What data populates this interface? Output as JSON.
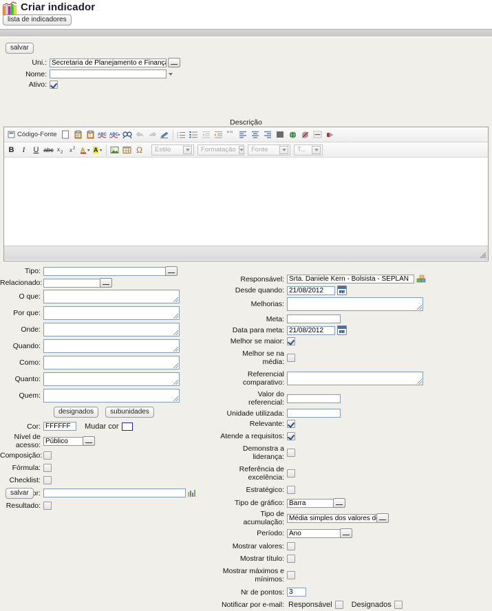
{
  "header": {
    "title": "Criar indicador",
    "logo_icon": "bar-chart-logo"
  },
  "nav": {
    "list_button": "lista de indicadores"
  },
  "actions": {
    "save_top": "salvar",
    "save_bottom": "salvar"
  },
  "top_fields": {
    "uni_label": "Uni.:",
    "uni_value": "Secretaria de Planejamento e Finanças",
    "nome_label": "Nome:",
    "nome_value": "",
    "ativo_label": "Ativo:",
    "ativo_checked": true
  },
  "description": {
    "label": "Descrição",
    "body_value": ""
  },
  "editor": {
    "row1": [
      {
        "name": "source-icon",
        "label": "Código-Fonte"
      },
      {
        "name": "new-page-icon"
      },
      {
        "name": "paste-word-icon"
      },
      {
        "name": "paste-text-icon"
      },
      {
        "name": "spellcheck-icon"
      },
      {
        "name": "spellcheck-options-icon"
      },
      {
        "name": "find-replace-icon"
      },
      {
        "name": "undo-icon"
      },
      {
        "name": "redo-icon"
      },
      {
        "name": "remove-format-icon"
      },
      {
        "name": "numbered-list-icon"
      },
      {
        "name": "bulleted-list-icon"
      },
      {
        "name": "outdent-icon"
      },
      {
        "name": "indent-icon"
      },
      {
        "name": "blockquote-icon"
      },
      {
        "name": "align-left-icon"
      },
      {
        "name": "align-center-icon"
      },
      {
        "name": "align-right-icon"
      },
      {
        "name": "justify-icon"
      },
      {
        "name": "link-icon"
      },
      {
        "name": "unlink-icon"
      },
      {
        "name": "horizontal-rule-icon"
      },
      {
        "name": "anchor-icon"
      }
    ],
    "row2": [
      {
        "name": "bold-icon",
        "glyph": "B"
      },
      {
        "name": "italic-icon",
        "glyph": "I"
      },
      {
        "name": "underline-icon",
        "glyph": "U"
      },
      {
        "name": "strikethrough-icon",
        "glyph": "abc"
      },
      {
        "name": "subscript-icon",
        "glyph": "x2"
      },
      {
        "name": "superscript-icon",
        "glyph": "x2"
      },
      {
        "name": "text-color-icon",
        "glyph": "A"
      },
      {
        "name": "bg-color-icon",
        "glyph": "A"
      },
      {
        "name": "image-icon"
      },
      {
        "name": "table-icon"
      },
      {
        "name": "special-char-icon",
        "glyph": "Ω"
      }
    ],
    "selects": [
      {
        "name": "style-select",
        "label": "Estilo"
      },
      {
        "name": "format-select",
        "label": "Formatação"
      },
      {
        "name": "font-select",
        "label": "Fonte"
      },
      {
        "name": "size-select",
        "label": "T..."
      }
    ]
  },
  "left_column": {
    "tipo_label": "Tipo:",
    "tipo_value": "",
    "relacionado_label": "Relacionado:",
    "relacionado_value": "",
    "oque_label": "O que:",
    "oque_value": "",
    "porque_label": "Por que:",
    "porque_value": "",
    "onde_label": "Onde:",
    "onde_value": "",
    "quando_label": "Quando:",
    "quando_value": "",
    "como_label": "Como:",
    "como_value": "",
    "quanto_label": "Quanto:",
    "quanto_value": "",
    "quem_label": "Quem:",
    "quem_value": "",
    "designados_button": "designados",
    "subunidades_button": "subunidades",
    "cor_label": "Cor:",
    "cor_value": "FFFFFF",
    "mudar_cor_label": "Mudar cor",
    "nivel_acesso_label": "Nível de acesso:",
    "nivel_acesso_value": "Público",
    "composicao_label": "Composição:",
    "composicao_checked": false,
    "formula_label": "Fórmula:",
    "formula_checked": false,
    "checklist_label": "Checklist:",
    "checklist_checked": false,
    "superior_label": "Superior:",
    "superior_value": "",
    "resultado_label": "Resultado:",
    "resultado_checked": false
  },
  "right_column": {
    "responsavel_label": "Responsável:",
    "responsavel_value": "Srta. Daniele Kern - Bolsista - SEPLAN",
    "desde_quando_label": "Desde quando:",
    "desde_quando_value": "21/08/2012",
    "melhorias_label": "Melhorias:",
    "melhorias_value": "",
    "meta_label": "Meta:",
    "meta_value": "",
    "data_meta_label": "Data para meta:",
    "data_meta_value": "21/08/2012",
    "melhor_maior_label": "Melhor se maior:",
    "melhor_maior_checked": true,
    "melhor_media_label": "Melhor se na média:",
    "melhor_media_checked": false,
    "referencial_comp_label": "Referencial comparativo:",
    "referencial_comp_value": "",
    "valor_referencial_label": "Valor do referencial:",
    "valor_referencial_value": "",
    "unidade_label": "Unidade utilizada:",
    "unidade_value": "",
    "relevante_label": "Relevante:",
    "relevante_checked": true,
    "atende_label": "Atende a requisitos:",
    "atende_checked": true,
    "lideranca_label": "Demonstra a liderança:",
    "lideranca_checked": false,
    "excelencia_label": "Referência de excelência:",
    "excelencia_checked": false,
    "estrategico_label": "Estratégico:",
    "estrategico_checked": false,
    "tipo_grafico_label": "Tipo de gráfico:",
    "tipo_grafico_value": "Barra",
    "tipo_acumulacao_label": "Tipo de acumulação:",
    "tipo_acumulacao_value": "Média simples dos valores do período",
    "periodo_label": "Período:",
    "periodo_value": "Ano",
    "mostrar_valores_label": "Mostrar valores:",
    "mostrar_valores_checked": false,
    "mostrar_titulo_label": "Mostrar título:",
    "mostrar_titulo_checked": false,
    "mostrar_maxmin_label": "Mostrar máximos e mínimos:",
    "mostrar_maxmin_checked": false,
    "nr_pontos_label": "Nr de pontos:",
    "nr_pontos_value": "3",
    "notificar_label": "Notificar por e-mail:",
    "notificar_responsavel_label": "Responsável",
    "notificar_responsavel_checked": false,
    "notificar_designados_label": "Designados",
    "notificar_designados_checked": false
  },
  "colors": {
    "page_bg": "#f1efe9",
    "input_border": "#7f9db9",
    "accent": "#2a4b8d"
  }
}
